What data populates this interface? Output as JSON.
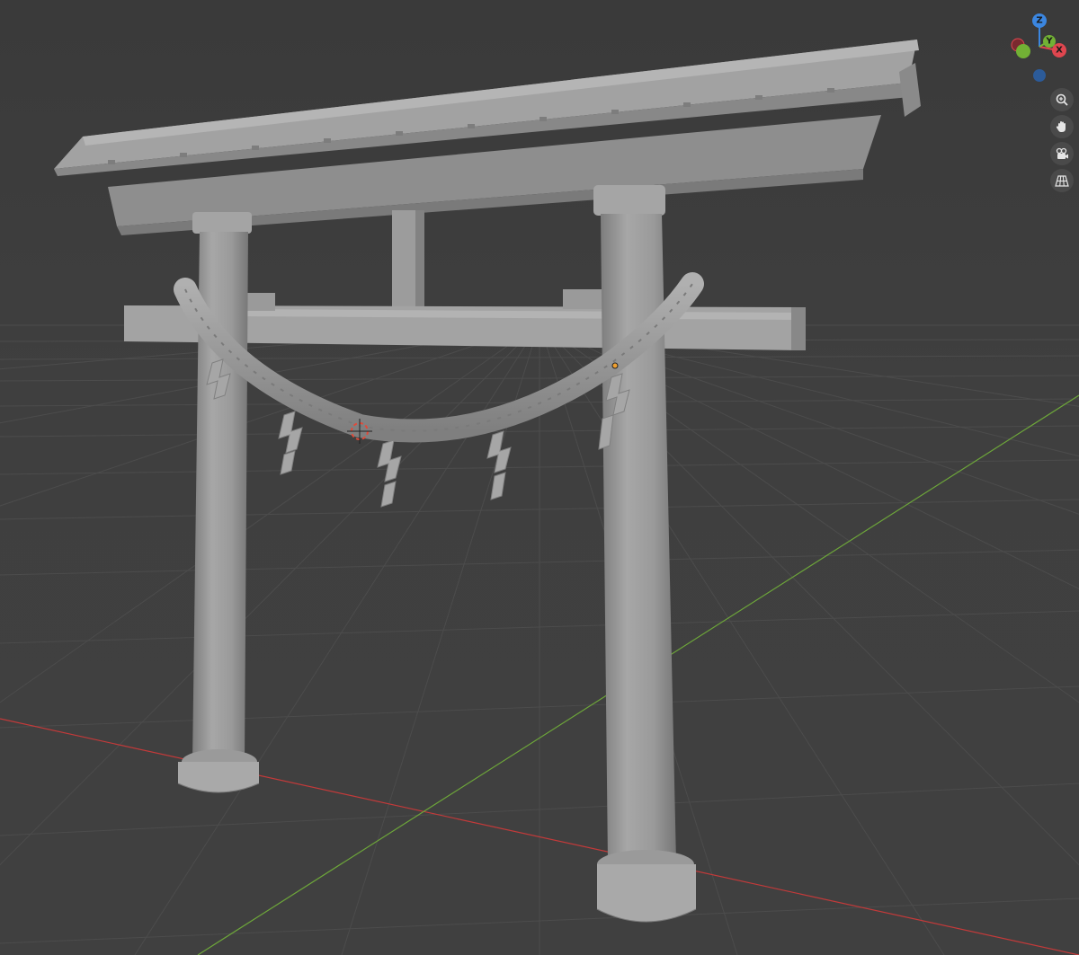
{
  "viewport": {
    "background": "#3d3d3d",
    "grid_color": "#4c4c4c",
    "x_axis_color": "#c33a3a",
    "y_axis_color": "#6da63a",
    "model_color": "#9a9a9a"
  },
  "gizmo": {
    "z_label": "Z",
    "y_label": "Y",
    "x_label": "X",
    "colors": {
      "x": "#e0464f",
      "y": "#72b135",
      "z": "#3b86e0"
    }
  },
  "nav_tools": [
    {
      "name": "zoom",
      "icon": "zoom-icon"
    },
    {
      "name": "pan",
      "icon": "hand-icon"
    },
    {
      "name": "camera",
      "icon": "camera-icon"
    },
    {
      "name": "perspective",
      "icon": "grid-perspective-icon"
    }
  ]
}
